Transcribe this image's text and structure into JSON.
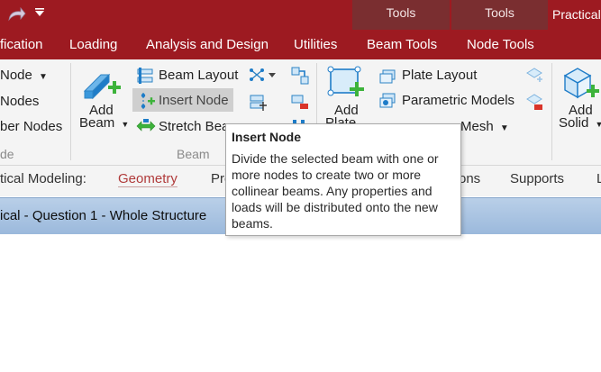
{
  "ribbon_tabs": {
    "fication": "fication",
    "loading": "Loading",
    "analysis_design": "Analysis and Design",
    "utilities": "Utilities",
    "beam_tools": "Beam Tools",
    "node_tools": "Node Tools"
  },
  "contextual": {
    "tools_beam": "Tools",
    "tools_node": "Tools",
    "practical": "Practical"
  },
  "ribbon": {
    "node_dropdown": "Node",
    "nodes": "Nodes",
    "ber_nodes": "ber Nodes",
    "left_group_label": "de",
    "add_beam": [
      "Add",
      "Beam"
    ],
    "beam_layout": "Beam Layout",
    "insert_node": "Insert Node",
    "stretch_beam": "Stretch Bea",
    "beam_group_label": "Beam",
    "add_plate": [
      "Add",
      "Plate"
    ],
    "plate_layout": "Plate Layout",
    "parametric_models": "Parametric Models",
    "mesh": "Mesh",
    "add_solid": [
      "Add",
      "Solid"
    ]
  },
  "page_tabs": {
    "mode": "tical Modeling:",
    "geometry": "Geometry",
    "pro": "Pro",
    "ons": "ons",
    "supports": "Supports",
    "l": "L"
  },
  "document": {
    "title": "ical - Question 1 - Whole Structure"
  },
  "tooltip": {
    "title": "Insert Node",
    "body": "Divide the selected beam with one or more nodes to create two or more collinear beams. Any properties and loads will be distributed onto the new beams."
  },
  "colors": {
    "ribbon_red": "#9d1a21",
    "contextual": "#7a2e30",
    "accent_blue": "#1e88d6",
    "accent_green": "#3db33b"
  }
}
